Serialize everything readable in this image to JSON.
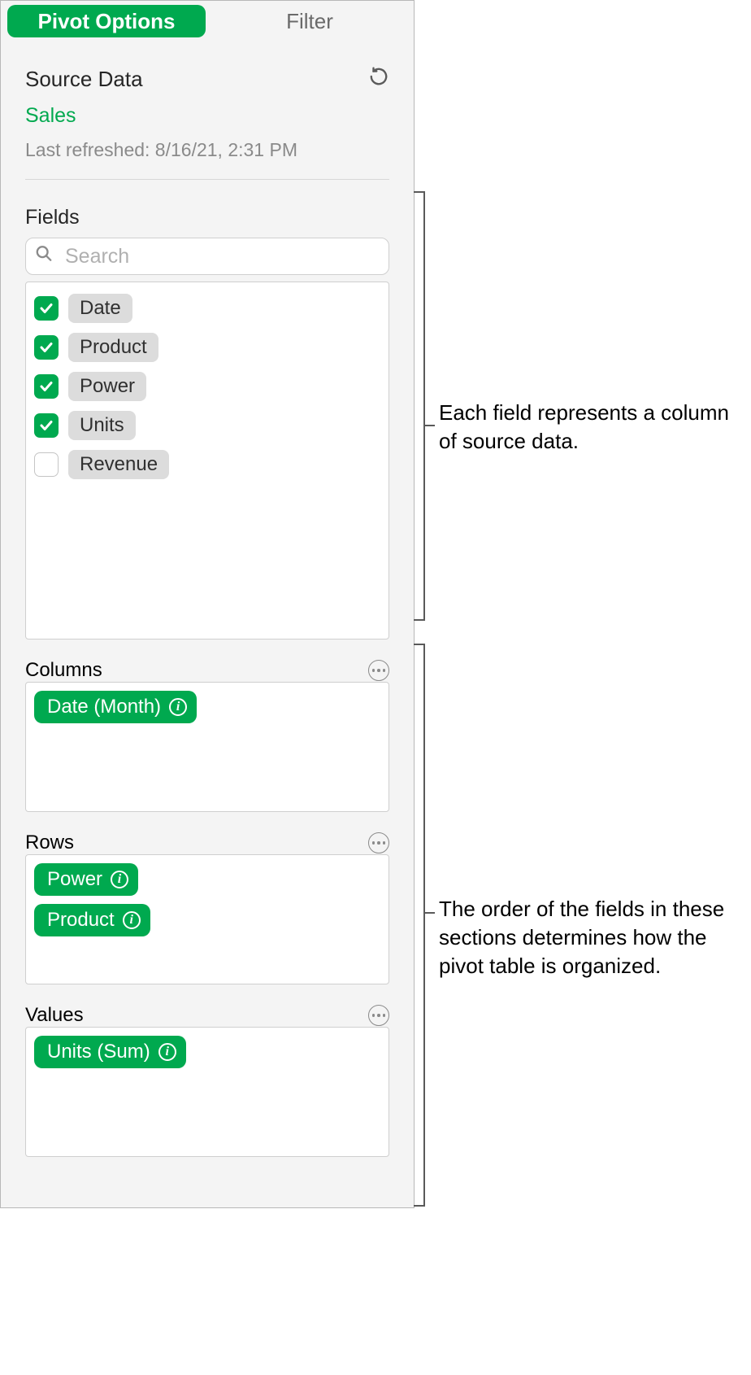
{
  "tabs": {
    "pivot": "Pivot Options",
    "filter": "Filter"
  },
  "source": {
    "heading": "Source Data",
    "name": "Sales",
    "refreshed": "Last refreshed: 8/16/21, 2:31 PM"
  },
  "fields": {
    "heading": "Fields",
    "search_placeholder": "Search",
    "items": [
      {
        "label": "Date",
        "checked": true
      },
      {
        "label": "Product",
        "checked": true
      },
      {
        "label": "Power",
        "checked": true
      },
      {
        "label": "Units",
        "checked": true
      },
      {
        "label": "Revenue",
        "checked": false
      }
    ]
  },
  "sections": {
    "columns": {
      "heading": "Columns",
      "items": [
        "Date (Month)"
      ]
    },
    "rows": {
      "heading": "Rows",
      "items": [
        "Power",
        "Product"
      ]
    },
    "values": {
      "heading": "Values",
      "items": [
        "Units (Sum)"
      ]
    }
  },
  "callouts": {
    "fields": "Each field represents a column of source data.",
    "sections": "The order of the fields in these sections determines how the pivot table is organized."
  },
  "colors": {
    "accent": "#00a94f"
  }
}
